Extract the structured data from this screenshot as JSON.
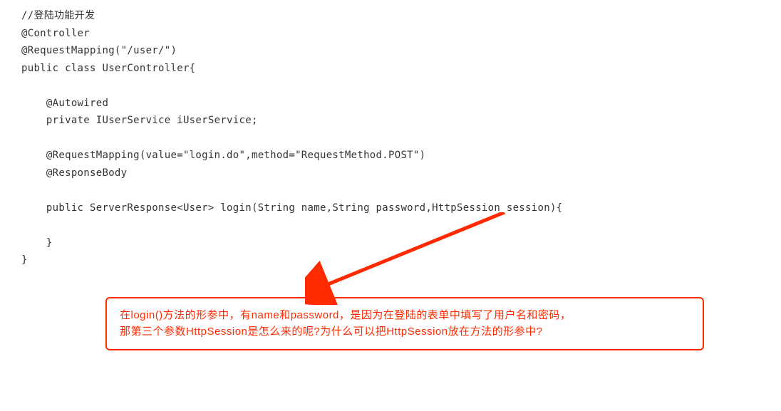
{
  "code_lines": [
    "//登陆功能开发",
    "@Controller",
    "@RequestMapping(\"/user/\")",
    "public class UserController{",
    "",
    "    @Autowired",
    "    private IUserService iUserService;",
    "",
    "    @RequestMapping(value=\"login.do\",method=\"RequestMethod.POST\")",
    "    @ResponseBody",
    "",
    "    public ServerResponse<User> login(String name,String password,HttpSession session){",
    "",
    "    }",
    "}"
  ],
  "callout": {
    "line1": "在login()方法的形参中，有name和password，是因为在登陆的表单中填写了用户名和密码，",
    "line2": "那第三个参数HttpSession是怎么来的呢?为什么可以把HttpSession放在方法的形参中?"
  }
}
